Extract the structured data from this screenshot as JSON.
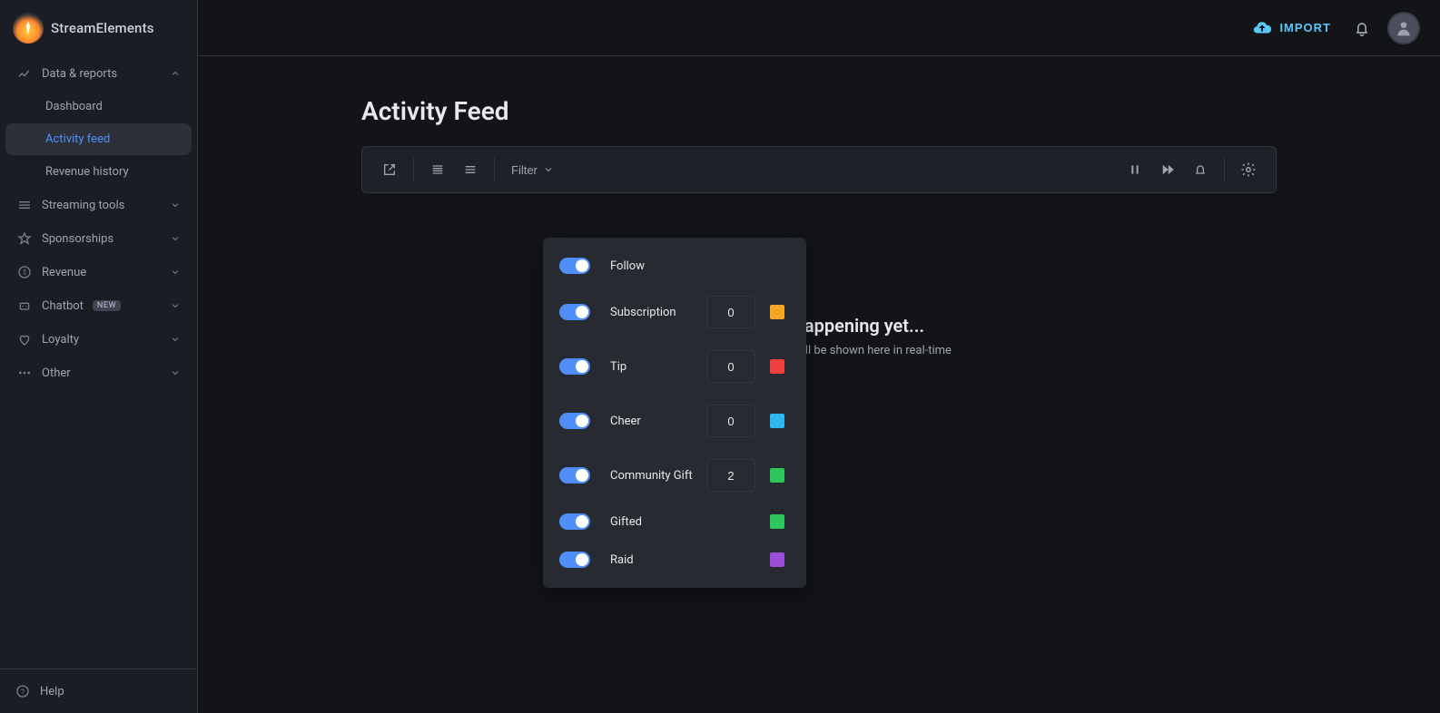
{
  "brand": {
    "name": "StreamElements"
  },
  "topbar": {
    "import_label": "IMPORT"
  },
  "sidebar": {
    "sections": [
      {
        "label": "Data & reports",
        "expanded": true,
        "items": [
          {
            "label": "Dashboard"
          },
          {
            "label": "Activity feed",
            "active": true
          },
          {
            "label": "Revenue history"
          }
        ]
      },
      {
        "label": "Streaming tools"
      },
      {
        "label": "Sponsorships"
      },
      {
        "label": "Revenue"
      },
      {
        "label": "Chatbot",
        "badge": "NEW"
      },
      {
        "label": "Loyalty"
      },
      {
        "label": "Other"
      }
    ],
    "help_label": "Help"
  },
  "page": {
    "title": "Activity Feed",
    "toolbar": {
      "filter_label": "Filter"
    },
    "empty": {
      "heading": "Nothing's happening yet...",
      "body": "Your stream activity will be shown here in real-time"
    }
  },
  "filter": {
    "rows": [
      {
        "label": "Follow",
        "value": null,
        "color": "#3b5bff"
      },
      {
        "label": "Subscription",
        "value": "0",
        "color": "#f6a623"
      },
      {
        "label": "Tip",
        "value": "0",
        "color": "#ef3e3e"
      },
      {
        "label": "Cheer",
        "value": "0",
        "color": "#2fb8ef"
      },
      {
        "label": "Community Gift",
        "value": "2",
        "color": "#2ec75c"
      },
      {
        "label": "Gifted",
        "value": null,
        "color": "#2ec75c"
      },
      {
        "label": "Raid",
        "value": null,
        "color": "#9b4fd9"
      }
    ]
  }
}
